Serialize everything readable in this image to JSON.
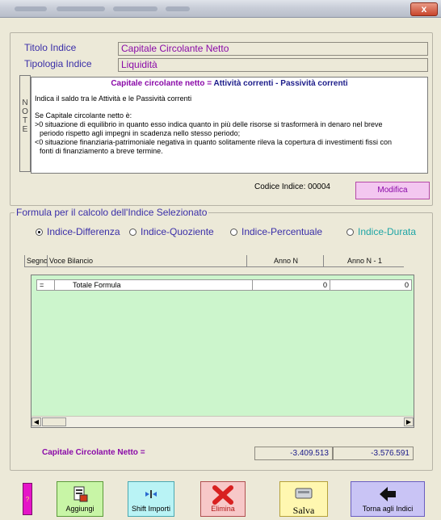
{
  "window": {
    "close_label": "x"
  },
  "header": {
    "titolo_label": "Titolo Indice",
    "titolo_value": "Capitale Circolante Netto",
    "tipologia_label": "Tipologia Indice",
    "tipologia_value": "Liquidità"
  },
  "notes": {
    "tab_letters": [
      "N",
      "O",
      "T",
      "E"
    ],
    "title_part1": "Capitale circolante netto = ",
    "title_part2": "Attività correnti - Passività correnti",
    "lines": [
      "Indica il saldo tra le Attività e le Passività correnti",
      "",
      "Se Capitale circolante netto è:",
      ">0 situazione di equilibrio in quanto esso indica quanto in più delle risorse si trasformerà in denaro nel breve",
      "   periodo rispetto agli impegni in scadenza nello stesso periodo;",
      "<0 situazione finanziaria-patrimoniale negativa in quanto solitamente rileva la copertura di investimenti fissi con",
      "   fonti di finanziamento a breve termine."
    ]
  },
  "codice": "Codice Indice: 00004",
  "modifica_label": "Modifica",
  "formula": {
    "legend": "Formula per il calcolo dell'Indice Selezionato",
    "options": {
      "differenza": "Indice-Differenza",
      "quoziente": "Indice-Quoziente",
      "percentuale": "Indice-Percentuale",
      "durata": "Indice-Durata"
    },
    "selected": "Indice-Differenza"
  },
  "grid": {
    "headers": {
      "segno": "Segno",
      "voce": "Voce Bilancio",
      "anno_n": "Anno N",
      "anno_n1": "Anno N - 1"
    },
    "rows": [
      {
        "segno": "=",
        "voce": "Totale Formula",
        "anno_n": "0",
        "anno_n1": "0"
      }
    ]
  },
  "totals": {
    "label": "Capitale Circolante Netto =",
    "anno_n": "-3.409.513",
    "anno_n1": "-3.576.591"
  },
  "buttons": {
    "help": "?",
    "aggiungi": "Aggiungi",
    "shift": "Shift Importi",
    "elimina": "Elimina",
    "salva": "Salva",
    "torna": "Torna agli Indici"
  },
  "colors": {
    "accent": "#8a0aa8",
    "label_blue": "#3a2ea8",
    "grid_green": "#ccf5cc"
  }
}
